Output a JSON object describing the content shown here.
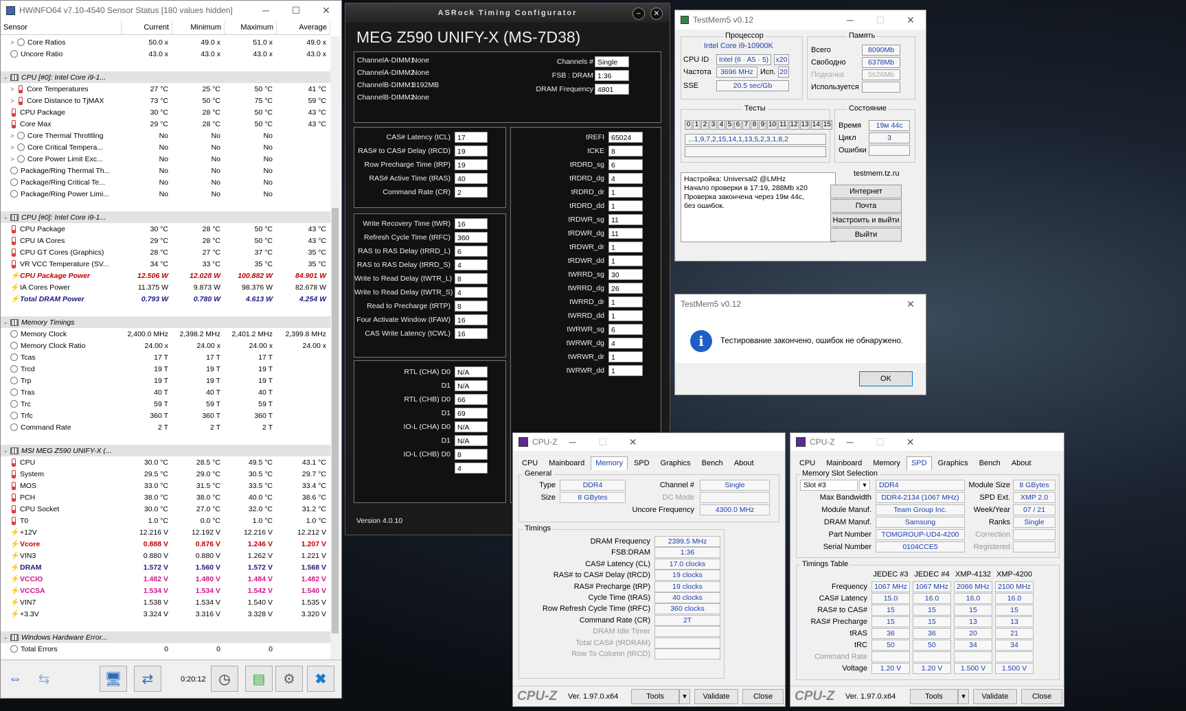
{
  "hwinfo": {
    "title": "HWiNFO64 v7.10-4540 Sensor Status [180 values hidden]",
    "headers": [
      "Sensor",
      "Current",
      "Minimum",
      "Maximum",
      "Average"
    ],
    "rows": [
      {
        "t": "r",
        "e": ">",
        "i": "c",
        "n": "Core Ratios",
        "v": [
          "50.0 x",
          "49.0 x",
          "51.0 x",
          "49.0 x"
        ],
        "ind": 1
      },
      {
        "t": "r",
        "e": "",
        "i": "c",
        "n": "Uncore Ratio",
        "v": [
          "43.0 x",
          "43.0 x",
          "43.0 x",
          "43.0 x"
        ]
      },
      {
        "t": "gap"
      },
      {
        "t": "g",
        "n": "CPU [#0]: Intel Core i9-1..."
      },
      {
        "t": "r",
        "e": ">",
        "i": "th",
        "n": "Core Temperatures",
        "v": [
          "27 °C",
          "25 °C",
          "50 °C",
          "41 °C"
        ],
        "ind": 1
      },
      {
        "t": "r",
        "e": ">",
        "i": "th",
        "n": "Core Distance to TjMAX",
        "v": [
          "73 °C",
          "50 °C",
          "75 °C",
          "59 °C"
        ],
        "ind": 1
      },
      {
        "t": "r",
        "e": "",
        "i": "th",
        "n": "CPU Package",
        "v": [
          "30 °C",
          "28 °C",
          "50 °C",
          "43 °C"
        ]
      },
      {
        "t": "r",
        "e": "",
        "i": "th",
        "n": "Core Max",
        "v": [
          "29 °C",
          "28 °C",
          "50 °C",
          "43 °C"
        ]
      },
      {
        "t": "r",
        "e": ">",
        "i": "c",
        "n": "Core Thermal Throttling",
        "v": [
          "No",
          "No",
          "No",
          ""
        ],
        "ind": 1
      },
      {
        "t": "r",
        "e": ">",
        "i": "c",
        "n": "Core Critical Tempera...",
        "v": [
          "No",
          "No",
          "No",
          ""
        ],
        "ind": 1
      },
      {
        "t": "r",
        "e": ">",
        "i": "c",
        "n": "Core Power Limit Exc...",
        "v": [
          "No",
          "No",
          "No",
          ""
        ],
        "ind": 1
      },
      {
        "t": "r",
        "e": "",
        "i": "c",
        "n": "Package/Ring Thermal Th...",
        "v": [
          "No",
          "No",
          "No",
          ""
        ]
      },
      {
        "t": "r",
        "e": "",
        "i": "c",
        "n": "Package/Ring Critical Te...",
        "v": [
          "No",
          "No",
          "No",
          ""
        ]
      },
      {
        "t": "r",
        "e": "",
        "i": "c",
        "n": "Package/Ring Power Limi...",
        "v": [
          "No",
          "No",
          "No",
          ""
        ]
      },
      {
        "t": "gap"
      },
      {
        "t": "g",
        "n": "CPU [#0]: Intel Core i9-1..."
      },
      {
        "t": "r",
        "e": "",
        "i": "th",
        "n": "CPU Package",
        "v": [
          "30 °C",
          "28 °C",
          "50 °C",
          "43 °C"
        ]
      },
      {
        "t": "r",
        "e": "",
        "i": "th",
        "n": "CPU IA Cores",
        "v": [
          "29 °C",
          "28 °C",
          "50 °C",
          "43 °C"
        ]
      },
      {
        "t": "r",
        "e": "",
        "i": "th",
        "n": "CPU GT Cores (Graphics)",
        "v": [
          "28 °C",
          "27 °C",
          "37 °C",
          "35 °C"
        ]
      },
      {
        "t": "r",
        "e": "",
        "i": "th",
        "n": "VR VCC Temperature (SV...",
        "v": [
          "34 °C",
          "33 °C",
          "35 °C",
          "35 °C"
        ]
      },
      {
        "t": "r",
        "e": "",
        "i": "b",
        "n": "CPU Package Power",
        "v": [
          "12.506 W",
          "12.028 W",
          "100.882 W",
          "84.901 W"
        ],
        "s": "red"
      },
      {
        "t": "r",
        "e": "",
        "i": "b",
        "n": "IA Cores Power",
        "v": [
          "11.375 W",
          "9.873 W",
          "98.376 W",
          "82.678 W"
        ]
      },
      {
        "t": "r",
        "e": "",
        "i": "b",
        "n": "Total DRAM Power",
        "v": [
          "0.793 W",
          "0.780 W",
          "4.613 W",
          "4.254 W"
        ],
        "s": "blue"
      },
      {
        "t": "gap"
      },
      {
        "t": "g",
        "n": "Memory Timings"
      },
      {
        "t": "r",
        "e": "",
        "i": "c",
        "n": "Memory Clock",
        "v": [
          "2,400.0 MHz",
          "2,398.2 MHz",
          "2,401.2 MHz",
          "2,399.8 MHz"
        ]
      },
      {
        "t": "r",
        "e": "",
        "i": "c",
        "n": "Memory Clock Ratio",
        "v": [
          "24.00 x",
          "24.00 x",
          "24.00 x",
          "24.00 x"
        ]
      },
      {
        "t": "r",
        "e": "",
        "i": "c",
        "n": "Tcas",
        "v": [
          "17 T",
          "17 T",
          "17 T",
          ""
        ]
      },
      {
        "t": "r",
        "e": "",
        "i": "c",
        "n": "Trcd",
        "v": [
          "19 T",
          "19 T",
          "19 T",
          ""
        ]
      },
      {
        "t": "r",
        "e": "",
        "i": "c",
        "n": "Trp",
        "v": [
          "19 T",
          "19 T",
          "19 T",
          ""
        ]
      },
      {
        "t": "r",
        "e": "",
        "i": "c",
        "n": "Tras",
        "v": [
          "40 T",
          "40 T",
          "40 T",
          ""
        ]
      },
      {
        "t": "r",
        "e": "",
        "i": "c",
        "n": "Trc",
        "v": [
          "59 T",
          "59 T",
          "59 T",
          ""
        ]
      },
      {
        "t": "r",
        "e": "",
        "i": "c",
        "n": "Trfc",
        "v": [
          "360 T",
          "360 T",
          "360 T",
          ""
        ]
      },
      {
        "t": "r",
        "e": "",
        "i": "c",
        "n": "Command Rate",
        "v": [
          "2 T",
          "2 T",
          "2 T",
          ""
        ]
      },
      {
        "t": "gap"
      },
      {
        "t": "g",
        "n": "MSI MEG Z590 UNIFY-X (..."
      },
      {
        "t": "r",
        "e": "",
        "i": "th",
        "n": "CPU",
        "v": [
          "30.0 °C",
          "28.5 °C",
          "49.5 °C",
          "43.1 °C"
        ]
      },
      {
        "t": "r",
        "e": "",
        "i": "th",
        "n": "System",
        "v": [
          "29.5 °C",
          "29.0 °C",
          "30.5 °C",
          "29.7 °C"
        ]
      },
      {
        "t": "r",
        "e": "",
        "i": "th",
        "n": "MOS",
        "v": [
          "33.0 °C",
          "31.5 °C",
          "33.5 °C",
          "33.4 °C"
        ]
      },
      {
        "t": "r",
        "e": "",
        "i": "th",
        "n": "PCH",
        "v": [
          "38.0 °C",
          "38.0 °C",
          "40.0 °C",
          "38.6 °C"
        ]
      },
      {
        "t": "r",
        "e": "",
        "i": "th",
        "n": "CPU Socket",
        "v": [
          "30.0 °C",
          "27.0 °C",
          "32.0 °C",
          "31.2 °C"
        ]
      },
      {
        "t": "r",
        "e": "",
        "i": "th",
        "n": "T0",
        "v": [
          "1.0 °C",
          "0.0 °C",
          "1.0 °C",
          "1.0 °C"
        ]
      },
      {
        "t": "r",
        "e": "",
        "i": "b",
        "n": "+12V",
        "v": [
          "12.216 V",
          "12.192 V",
          "12.216 V",
          "12.212 V"
        ]
      },
      {
        "t": "r",
        "e": "",
        "i": "b",
        "n": "Vcore",
        "v": [
          "0.888 V",
          "0.876 V",
          "1.246 V",
          "1.207 V"
        ],
        "s": "rb"
      },
      {
        "t": "r",
        "e": "",
        "i": "b",
        "n": "VIN3",
        "v": [
          "0.880 V",
          "0.880 V",
          "1.262 V",
          "1.221 V"
        ]
      },
      {
        "t": "r",
        "e": "",
        "i": "b",
        "n": "DRAM",
        "v": [
          "1.572 V",
          "1.560 V",
          "1.572 V",
          "1.568 V"
        ],
        "s": "db"
      },
      {
        "t": "r",
        "e": "",
        "i": "b",
        "n": "VCCIO",
        "v": [
          "1.482 V",
          "1.480 V",
          "1.484 V",
          "1.482 V"
        ],
        "s": "mg"
      },
      {
        "t": "r",
        "e": "",
        "i": "b",
        "n": "VCCSA",
        "v": [
          "1.534 V",
          "1.534 V",
          "1.542 V",
          "1.540 V"
        ],
        "s": "mg"
      },
      {
        "t": "r",
        "e": "",
        "i": "b",
        "n": "VIN7",
        "v": [
          "1.538 V",
          "1.534 V",
          "1.540 V",
          "1.535 V"
        ]
      },
      {
        "t": "r",
        "e": "",
        "i": "b",
        "n": "+3.3V",
        "v": [
          "3.324 V",
          "3.316 V",
          "3.328 V",
          "3.320 V"
        ]
      },
      {
        "t": "gap"
      },
      {
        "t": "g",
        "n": "Windows Hardware Error..."
      },
      {
        "t": "r",
        "e": "",
        "i": "c",
        "n": "Total Errors",
        "v": [
          "0",
          "0",
          "0",
          ""
        ]
      }
    ],
    "timer": "0:20:12"
  },
  "asrock": {
    "title": "ASRock Timing Configurator",
    "board": "MEG Z590 UNIFY-X (MS-7D38)",
    "dimms": [
      [
        "ChannelA-DIMM1",
        "None"
      ],
      [
        "ChannelA-DIMM2",
        "None"
      ],
      [
        "ChannelB-DIMM1",
        "8192MB"
      ],
      [
        "ChannelB-DIMM2",
        "None"
      ]
    ],
    "top_right": [
      [
        "Channels #",
        "Single"
      ],
      [
        "FSB : DRAM",
        "1:36"
      ],
      [
        "DRAM Frequency",
        "4801"
      ]
    ],
    "primary": [
      [
        "CAS# Latency (tCL)",
        "17"
      ],
      [
        "RAS# to CAS# Delay (tRCD)",
        "19"
      ],
      [
        "Row Precharge Time (tRP)",
        "19"
      ],
      [
        "RAS# Active Time (tRAS)",
        "40"
      ],
      [
        "Command Rate (CR)",
        "2"
      ]
    ],
    "secondary": [
      [
        "Write Recovery Time (tWR)",
        "16"
      ],
      [
        "Refresh Cycle Time (tRFC)",
        "360"
      ],
      [
        "RAS to RAS Delay (tRRD_L)",
        "6"
      ],
      [
        "RAS to RAS Delay (tRRD_S)",
        "4"
      ],
      [
        "Write to Read Delay (tWTR_L)",
        "8"
      ],
      [
        "Write to Read Delay (tWTR_S)",
        "4"
      ],
      [
        "Read to Precharge (tRTP)",
        "8"
      ],
      [
        "Four Activate Window (tFAW)",
        "16"
      ],
      [
        "CAS Write Latency (tCWL)",
        "16"
      ]
    ],
    "rtl": [
      [
        "RTL (CHA) D0",
        "N/A"
      ],
      [
        "D1",
        "N/A"
      ],
      [
        "RTL (CHB) D0",
        "66"
      ],
      [
        "D1",
        "69"
      ],
      [
        "IO-L (CHA) D0",
        "N/A"
      ],
      [
        "D1",
        "N/A"
      ],
      [
        "IO-L (CHB) D0",
        "8"
      ],
      [
        "",
        "4"
      ]
    ],
    "right": [
      [
        "tREFI",
        "65024"
      ],
      [
        "tCKE",
        "8"
      ],
      [
        "tRDRD_sg",
        "6"
      ],
      [
        "tRDRD_dg",
        "4"
      ],
      [
        "tRDRD_dr",
        "1"
      ],
      [
        "tRDRD_dd",
        "1"
      ],
      [
        "tRDWR_sg",
        "11"
      ],
      [
        "tRDWR_dg",
        "11"
      ],
      [
        "tRDWR_dr",
        "1"
      ],
      [
        "tRDWR_dd",
        "1"
      ],
      [
        "tWRRD_sg",
        "30"
      ],
      [
        "tWRRD_dg",
        "26"
      ],
      [
        "tWRRD_dr",
        "1"
      ],
      [
        "tWRRD_dd",
        "1"
      ],
      [
        "tWRWR_sg",
        "6"
      ],
      [
        "tWRWR_dg",
        "4"
      ],
      [
        "tWRWR_dr",
        "1"
      ],
      [
        "tWRWR_dd",
        "1"
      ]
    ],
    "version": "Version 4.0.10"
  },
  "testmem": {
    "title": "TestMem5 v0.12",
    "proc_label": "Процессор",
    "cpu_name": "Intel Core i9-10900K",
    "cpuid_label": "CPU ID",
    "cpuid": "Intel  (6 · A5 · 5)",
    "threads": "x20",
    "freq_label": "Частота",
    "freq": "3696 MHz",
    "use_label": "Исп.",
    "use": "20",
    "sse_label": "SSE",
    "sse": "20.5 sec/Gb",
    "mem_label": "Память",
    "total_label": "Всего",
    "total": "8090Mb",
    "free_label": "Свободно",
    "free": "6378Mb",
    "swap_label": "Подкачка",
    "swap": "5626Mb",
    "used_label": "Используется",
    "used": "",
    "tests_label": "Тесты",
    "tests": [
      "0",
      "1",
      "2",
      "3",
      "4",
      "5",
      "6",
      "7",
      "8",
      "9",
      "10",
      "11",
      "12",
      "13",
      "14",
      "15"
    ],
    "seq": "...1,9,7,2,15,14,1,13,5,2,3,1,8,2",
    "state_label": "Состояние",
    "time_label": "Время",
    "time": "19м 44с",
    "cycle_label": "Цикл",
    "cycle": "3",
    "err_label": "Ошибки",
    "err": "",
    "log": [
      "Настройка: Universal2 @LMHz",
      "Начало проверки в 17:19, 288Mb x20",
      "Проверка закончена через 19м 44с,",
      "без ошибок."
    ],
    "site": "testmem.tz.ru",
    "buttons": [
      "Интернет",
      "Почта",
      "Настроить и выйти",
      "Выйти"
    ]
  },
  "dialog": {
    "title": "TestMem5 v0.12",
    "message": "Тестирование закончено, ошибок не обнаружено.",
    "ok": "OK"
  },
  "cpuz_mem": {
    "title": "CPU-Z",
    "tabs": [
      "CPU",
      "Mainboard",
      "Memory",
      "SPD",
      "Graphics",
      "Bench",
      "About"
    ],
    "general_label": "General",
    "type_label": "Type",
    "type": "DDR4",
    "size_label": "Size",
    "size": "8 GBytes",
    "channel_label": "Channel #",
    "channel": "Single",
    "dcmode_label": "DC Mode",
    "dcmode": "",
    "uncore_label": "Uncore Frequency",
    "uncore": "4300.0 MHz",
    "timings_label": "Timings",
    "timings": [
      [
        "DRAM Frequency",
        "2399.5 MHz",
        0
      ],
      [
        "FSB:DRAM",
        "1:36",
        0
      ],
      [
        "CAS# Latency (CL)",
        "17.0 clocks",
        0
      ],
      [
        "RAS# to CAS# Delay (tRCD)",
        "19 clocks",
        0
      ],
      [
        "RAS# Precharge (tRP)",
        "19 clocks",
        0
      ],
      [
        "Cycle Time (tRAS)",
        "40 clocks",
        0
      ],
      [
        "Row Refresh Cycle Time (tRFC)",
        "360 clocks",
        0
      ],
      [
        "Command Rate (CR)",
        "2T",
        0
      ],
      [
        "DRAM Idle Timer",
        "",
        1
      ],
      [
        "Total CAS# (tRDRAM)",
        "",
        1
      ],
      [
        "Row To Column (tRCD)",
        "",
        1
      ]
    ],
    "brand": "CPU-Z",
    "ver": "Ver. 1.97.0.x64",
    "tools": "Tools",
    "validate": "Validate",
    "close": "Close"
  },
  "cpuz_spd": {
    "title": "CPU-Z",
    "tabs": [
      "CPU",
      "Mainboard",
      "Memory",
      "SPD",
      "Graphics",
      "Bench",
      "About"
    ],
    "slot_sel_label": "Memory Slot Selection",
    "slot": "Slot #3",
    "memtype": "DDR4",
    "modsize_label": "Module Size",
    "modsize": "8 GBytes",
    "maxbw_label": "Max Bandwidth",
    "maxbw": "DDR4-2134 (1067 MHz)",
    "spdext_label": "SPD Ext.",
    "spdext": "XMP 2.0",
    "modmanuf_label": "Module Manuf.",
    "modmanuf": "Team Group Inc.",
    "week_label": "Week/Year",
    "week": "07 / 21",
    "drammanuf_label": "DRAM Manuf.",
    "drammanuf": "Samsung",
    "ranks_label": "Ranks",
    "ranks": "Single",
    "part_label": "Part Number",
    "part": "TOMGROUP-UD4-4200",
    "corr_label": "Correction",
    "corr": "",
    "serial_label": "Serial Number",
    "serial": "0104CCE5",
    "reg_label": "Registered",
    "reg": "",
    "tt_label": "Timings Table",
    "cols": [
      "JEDEC #3",
      "JEDEC #4",
      "XMP-4132",
      "XMP-4200"
    ],
    "trows": [
      [
        "Frequency",
        [
          "1067 MHz",
          "1067 MHz",
          "2066 MHz",
          "2100 MHz"
        ],
        0
      ],
      [
        "CAS# Latency",
        [
          "15.0",
          "16.0",
          "16.0",
          "16.0"
        ],
        0
      ],
      [
        "RAS# to CAS#",
        [
          "15",
          "15",
          "15",
          "15"
        ],
        0
      ],
      [
        "RAS# Precharge",
        [
          "15",
          "15",
          "13",
          "13"
        ],
        0
      ],
      [
        "tRAS",
        [
          "36",
          "36",
          "20",
          "21"
        ],
        0
      ],
      [
        "tRC",
        [
          "50",
          "50",
          "34",
          "34"
        ],
        0
      ],
      [
        "Command Rate",
        [
          "",
          "",
          "",
          ""
        ],
        1
      ],
      [
        "Voltage",
        [
          "1.20 V",
          "1.20 V",
          "1.500 V",
          "1.500 V"
        ],
        0
      ]
    ],
    "brand": "CPU-Z",
    "ver": "Ver. 1.97.0.x64",
    "tools": "Tools",
    "validate": "Validate",
    "close": "Close"
  }
}
